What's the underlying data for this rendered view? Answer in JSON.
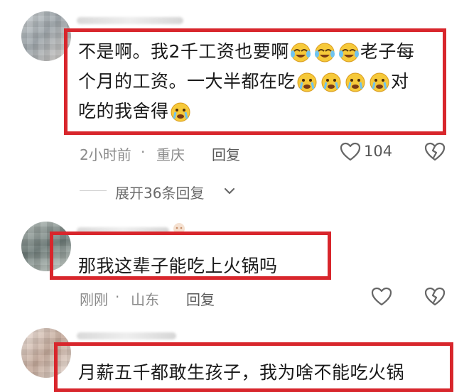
{
  "comments": [
    {
      "text_line1": "不是啊。我2千工资也要啊",
      "text_line1_tail": "老子每",
      "text_line2_head": "个月的工资。一大半都在吃",
      "text_line2_tail": "对",
      "text_line3": "吃的我舍得",
      "time": "2小时前",
      "separator": "·",
      "location": "重庆",
      "reply_label": "回复",
      "like_count": "104",
      "emojis": [
        "laugh-cry-emoji",
        "laugh-cry-emoji",
        "laugh-cry-emoji",
        "cry-emoji",
        "cry-emoji",
        "cry-emoji",
        "cry-emoji",
        "cry-emoji"
      ]
    },
    {
      "text": "那我这辈子能吃上火锅吗",
      "time": "刚刚",
      "separator": "·",
      "location": "山东",
      "reply_label": "回复"
    },
    {
      "text": "月薪五千都敢生孩子，我为啥不能吃火锅"
    }
  ],
  "expand": {
    "label": "展开36条回复",
    "icon": "chevron-down-icon"
  },
  "colors": {
    "highlight_frame": "#d8262c",
    "meta_text": "#8a8a8a"
  }
}
